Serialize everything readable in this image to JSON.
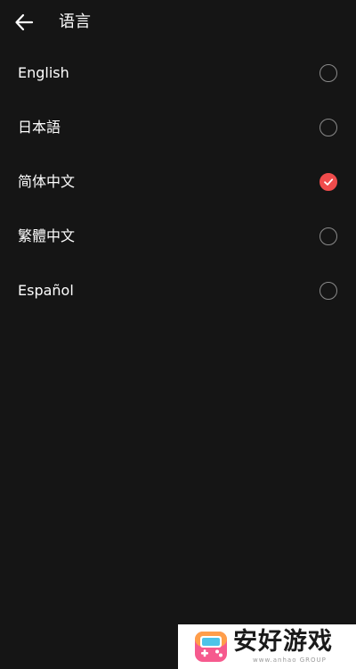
{
  "header": {
    "title": "语言",
    "back_icon": "arrow-left-icon"
  },
  "languages": [
    {
      "label": "English",
      "selected": false
    },
    {
      "label": "日本語",
      "selected": false
    },
    {
      "label": "简体中文",
      "selected": true
    },
    {
      "label": "繁體中文",
      "selected": false
    },
    {
      "label": "Español",
      "selected": false
    }
  ],
  "colors": {
    "background": "#151515",
    "accent": "#f04c4c",
    "radio_border": "#8a8a8a",
    "text": "#ffffff"
  },
  "watermark": {
    "text": "安好游戏",
    "subtext": "www.anhao GROUP"
  }
}
